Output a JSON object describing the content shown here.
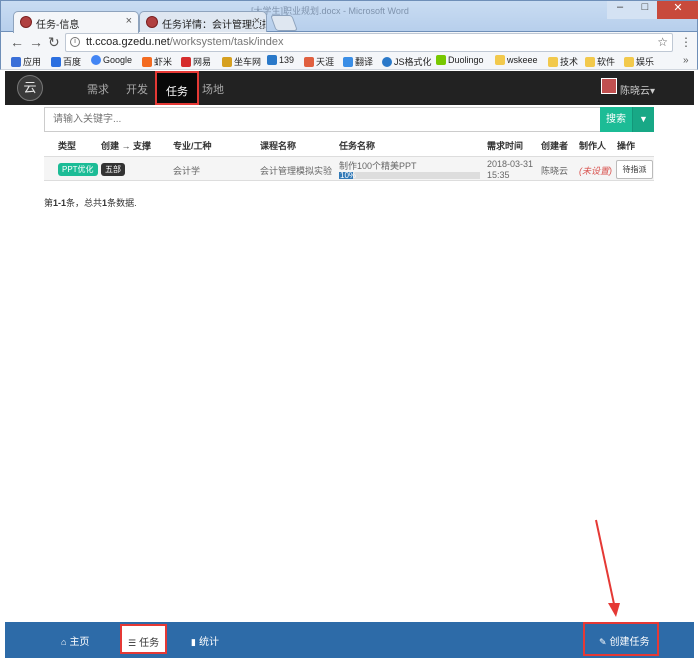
{
  "browser": {
    "window_title": "[大学生]职业规划.docx - Microsoft Word",
    "tabs": [
      {
        "title": "任务-信息",
        "active": true
      },
      {
        "title": "任务详情：会计管理模拟",
        "active": false
      }
    ],
    "url_host": "tt.ccoa.gzedu.net",
    "url_path": "/worksystem/task/index",
    "bookmarks": [
      {
        "label": "应用",
        "icon_color": "#3a6fd8"
      },
      {
        "label": "百度",
        "icon_color": "#2b6fe0"
      },
      {
        "label": "Google",
        "icon_color": "#4285f4"
      },
      {
        "label": "虾米",
        "icon_color": "#f36b21"
      },
      {
        "label": "网易",
        "icon_color": "#d62d2d"
      },
      {
        "label": "坐车网",
        "icon_color": "#d6a020"
      },
      {
        "label": "139",
        "icon_color": "#2a79c9"
      },
      {
        "label": "天涯",
        "icon_color": "#e06040"
      },
      {
        "label": "翻译",
        "icon_color": "#3a8ee6"
      },
      {
        "label": "JS格式化",
        "icon_color": "#2a79c9"
      },
      {
        "label": "Duolingo",
        "icon_color": "#78c800"
      },
      {
        "label": "wskeee",
        "icon_color": "#f2c94c"
      },
      {
        "label": "技术",
        "icon_color": "#f2c94c"
      },
      {
        "label": "软件",
        "icon_color": "#f2c94c"
      },
      {
        "label": "娱乐",
        "icon_color": "#f2c94c"
      }
    ]
  },
  "nav": {
    "logo_glyph": "云",
    "items": [
      "需求",
      "开发",
      "任务",
      "场地"
    ],
    "active": "任务",
    "user_name": "陈晓云"
  },
  "search": {
    "placeholder": "请输入关键字...",
    "button_label": "搜索",
    "caret": "▼"
  },
  "table": {
    "headers": [
      "类型",
      "创建 → 支撑",
      "专业/工种",
      "课程名称",
      "任务名称",
      "需求时间",
      "创建者",
      "制作人",
      "操作"
    ],
    "rows": [
      {
        "type_badge": "PPT优化",
        "dept_badge": "五部",
        "major": "会计学",
        "course": "会计管理模拟实验",
        "task_name": "制作100个精美PPT",
        "progress_label": "10%",
        "progress": 0.1,
        "date": "2018-03-31",
        "time": "15:35",
        "creator": "陈晓云",
        "maker": "(未设置)",
        "action": "待指派"
      }
    ],
    "summary_prefix": "第",
    "summary_range": "1-1",
    "summary_mid": "条，总共",
    "summary_total": "1",
    "summary_suffix": "条数据."
  },
  "bottom_bar": {
    "home": "主页",
    "tasks": "任务",
    "stats": "统计",
    "create": "创建任务"
  },
  "colors": {
    "accent_green": "#1cbc96",
    "bottom_blue": "#2d6ba8",
    "highlight_red": "#e53935",
    "nav_dark": "#222222"
  }
}
